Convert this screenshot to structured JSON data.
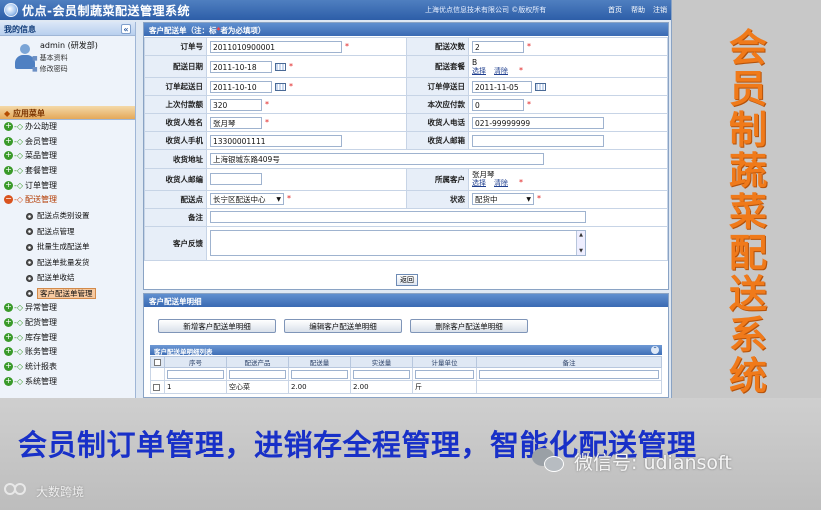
{
  "app": {
    "title": "优点-会员制蔬菜配送管理系统",
    "company": "上海优点信息技术有限公司 ©版权所有",
    "top_links": [
      "首页",
      "帮助",
      "注销"
    ]
  },
  "sidebar": {
    "my_info_title": "我的信息",
    "collapse_glyph": "«",
    "user": "admin (研发部)",
    "info_links": [
      "基本资料",
      "修改密码"
    ],
    "menu_title": "应用菜单",
    "menu_before": [
      "办公助理",
      "会员管理",
      "菜品管理",
      "套餐管理",
      "订单管理"
    ],
    "open_menu": "配送管理",
    "sub_items": [
      "配送点类别设置",
      "配送点管理",
      "批量生成配送单",
      "配送单批量发货",
      "配送单收结",
      "客户配送单管理"
    ],
    "selected_sub": "客户配送单管理",
    "menu_after": [
      "异常管理",
      "配货管理",
      "库存管理",
      "账务管理",
      "统计报表",
      "系统管理"
    ]
  },
  "form": {
    "header": "客户配送单",
    "header_note_prefix": "（注：标",
    "header_star": "*",
    "header_note_suffix": "者为必填项）",
    "labels": {
      "order_no": "订单号",
      "delivery_count": "配送次数",
      "delivery_date": "配送日期",
      "delivery_package": "配送套餐",
      "order_arrival_date": "订单起送日",
      "order_end_date": "订单停送日",
      "last_paid": "上次付款额",
      "this_due": "本次应付款",
      "receiver_name": "收货人姓名",
      "receiver_phone": "收货人电话",
      "receiver_mobile": "收货人手机",
      "receiver_email": "收货人邮箱",
      "address": "收货地址",
      "postcode": "收货人邮编",
      "customer": "所属客户",
      "delivery_point": "配送点",
      "status": "状态",
      "remark": "备注",
      "feedback": "客户反馈"
    },
    "values": {
      "order_no": "2011010900001",
      "delivery_count": "2",
      "delivery_date": "2011-10-18",
      "delivery_package": "B",
      "order_arrival_date": "2011-10-10",
      "order_end_date": "2011-11-05",
      "last_paid": "320",
      "this_due": "0",
      "receiver_name": "张月琴",
      "receiver_phone": "021-99999999",
      "receiver_mobile": "13300001111",
      "receiver_email": "",
      "address": "上海银城东路409号",
      "postcode": "",
      "customer": "张月琴",
      "delivery_point": "长宁区配送中心",
      "status": "配货中",
      "remark": "",
      "feedback": ""
    },
    "select_link": "选择",
    "clear_link": "清除",
    "back_button": "返回"
  },
  "details": {
    "header": "客户配送单明细",
    "buttons": [
      "新增客户配送单明细",
      "编辑客户配送单明细",
      "删除客户配送单明细"
    ],
    "grid_title": "客户配送单明细列表",
    "columns": [
      "序号",
      "配送产品",
      "配送量",
      "实送量",
      "计量单位",
      "备注"
    ],
    "rows": [
      [
        "1",
        "空心菜",
        "2.00",
        "2.00",
        "斤",
        ""
      ]
    ]
  },
  "promo": {
    "vertical_title_chars": [
      "会",
      "员",
      "制",
      "蔬",
      "菜",
      "配",
      "送",
      "系",
      "统"
    ],
    "banner_text": "会员制订单管理，进销存全程管理，智能化配送管理",
    "wechat_label": "微信号: udiansoft",
    "watermark_text": "大数跨境"
  },
  "colors": {
    "accent_blue": "#2d5ea8",
    "promo_orange": "#f07a1a",
    "banner_blue": "#1830c8",
    "required_red": "#e02020"
  }
}
